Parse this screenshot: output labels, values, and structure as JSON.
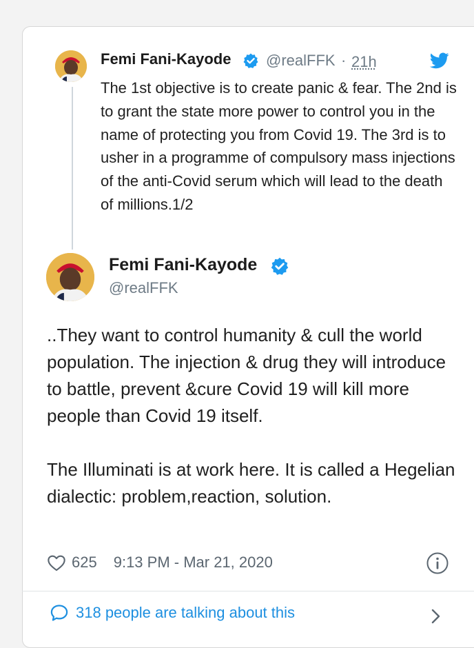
{
  "quoted_tweet": {
    "author_name": "Femi Fani-Kayode",
    "handle": "@realFFK",
    "separator": "·",
    "time_ago": "21h",
    "text": "The 1st objective is to create panic & fear. The 2nd is to grant the state more power to control you in the name of protecting you from Covid 19. The 3rd is to usher in a programme of compulsory mass injections of the anti-Covid serum which will lead to the death of millions.1/2"
  },
  "main_tweet": {
    "author_name": "Femi Fani-Kayode",
    "handle": "@realFFK",
    "paragraph1": "..They want to control humanity & cull the world population. The injection & drug they will introduce to battle, prevent &cure Covid 19 will kill more people than Covid 19 itself.",
    "paragraph2": "The Illuminati is at work here. It is called a Hegelian dialectic: problem,reaction, solution.",
    "like_count": "625",
    "timestamp": "9:13 PM - Mar 21, 2020"
  },
  "conversation": {
    "label": "318 people are talking about this"
  },
  "colors": {
    "accent": "#1d9bf0",
    "verified": "#1d9bf0",
    "muted_text": "#6e7b86"
  },
  "icons": [
    "twitter-bird-icon",
    "verified-badge-icon",
    "heart-icon",
    "info-icon",
    "speech-bubble-icon",
    "chevron-right-icon"
  ]
}
